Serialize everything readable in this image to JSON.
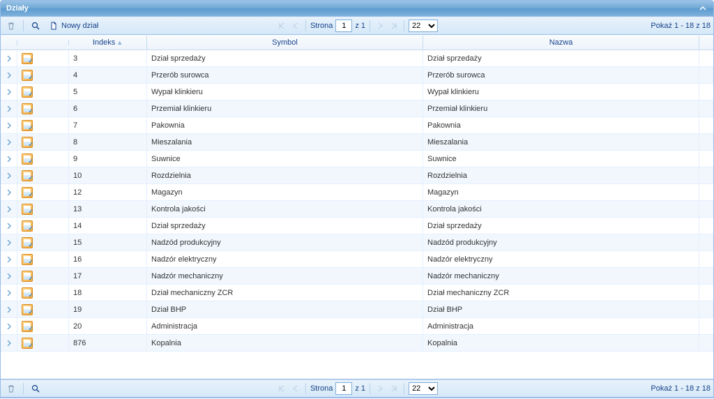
{
  "panel": {
    "title": "Działy"
  },
  "toolbar": {
    "new_label": "Nowy dział",
    "page_label": "Strona",
    "page_value": "1",
    "page_of": "z 1",
    "page_size": "22",
    "page_size_options": [
      "22"
    ],
    "status": "Pokaż 1 - 18 z 18"
  },
  "columns": {
    "indeks": "Indeks",
    "symbol": "Symbol",
    "nazwa": "Nazwa"
  },
  "rows": [
    {
      "indeks": "3",
      "symbol": "Dział sprzedaży",
      "nazwa": "Dział sprzedaży"
    },
    {
      "indeks": "4",
      "symbol": "Przerób surowca",
      "nazwa": "Przerób surowca"
    },
    {
      "indeks": "5",
      "symbol": "Wypał klinkieru",
      "nazwa": "Wypał klinkieru"
    },
    {
      "indeks": "6",
      "symbol": "Przemiał klinkieru",
      "nazwa": "Przemiał klinkieru"
    },
    {
      "indeks": "7",
      "symbol": "Pakownia",
      "nazwa": "Pakownia"
    },
    {
      "indeks": "8",
      "symbol": "Mieszalania",
      "nazwa": "Mieszalania"
    },
    {
      "indeks": "9",
      "symbol": "Suwnice",
      "nazwa": "Suwnice"
    },
    {
      "indeks": "10",
      "symbol": "Rozdzielnia",
      "nazwa": "Rozdzielnia"
    },
    {
      "indeks": "12",
      "symbol": "Magazyn",
      "nazwa": "Magazyn"
    },
    {
      "indeks": "13",
      "symbol": "Kontrola jakości",
      "nazwa": "Kontrola jakości"
    },
    {
      "indeks": "14",
      "symbol": "Dział sprzedaży",
      "nazwa": "Dział sprzedaży"
    },
    {
      "indeks": "15",
      "symbol": "Nadzód produkcyjny",
      "nazwa": "Nadzód produkcyjny"
    },
    {
      "indeks": "16",
      "symbol": "Nadzór elektryczny",
      "nazwa": "Nadzór elektryczny"
    },
    {
      "indeks": "17",
      "symbol": "Nadzór mechaniczny",
      "nazwa": "Nadzór mechaniczny"
    },
    {
      "indeks": "18",
      "symbol": "Dział mechaniczny ZCR",
      "nazwa": "Dział mechaniczny ZCR"
    },
    {
      "indeks": "19",
      "symbol": "Dział BHP",
      "nazwa": "Dział BHP"
    },
    {
      "indeks": "20",
      "symbol": "Administracja",
      "nazwa": "Administracja"
    },
    {
      "indeks": "876",
      "symbol": "Kopalnia",
      "nazwa": "Kopalnia"
    }
  ]
}
